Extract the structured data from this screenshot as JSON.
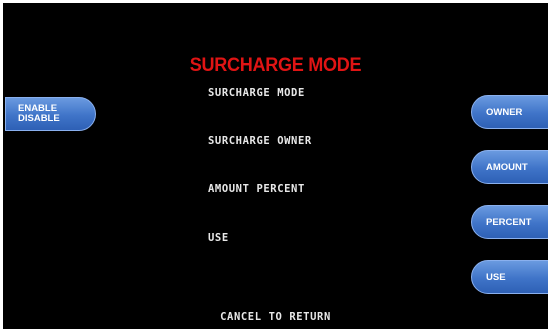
{
  "screen": {
    "title": "SURCHARGE MODE",
    "lines": [
      "SURCHARGE MODE",
      "SURCHARGE OWNER",
      "AMOUNT PERCENT",
      "USE"
    ],
    "footer": "CANCEL TO RETURN"
  },
  "left_keys": {
    "enable_disable": {
      "line1": "ENABLE",
      "line2": "DISABLE"
    }
  },
  "right_keys": {
    "owner": "OWNER",
    "amount": "AMOUNT",
    "percent": "PERCENT",
    "use": "USE"
  },
  "colors": {
    "background": "#000000",
    "title": "#e01414",
    "text": "#e8e8e8",
    "button": "#3f74c8"
  }
}
